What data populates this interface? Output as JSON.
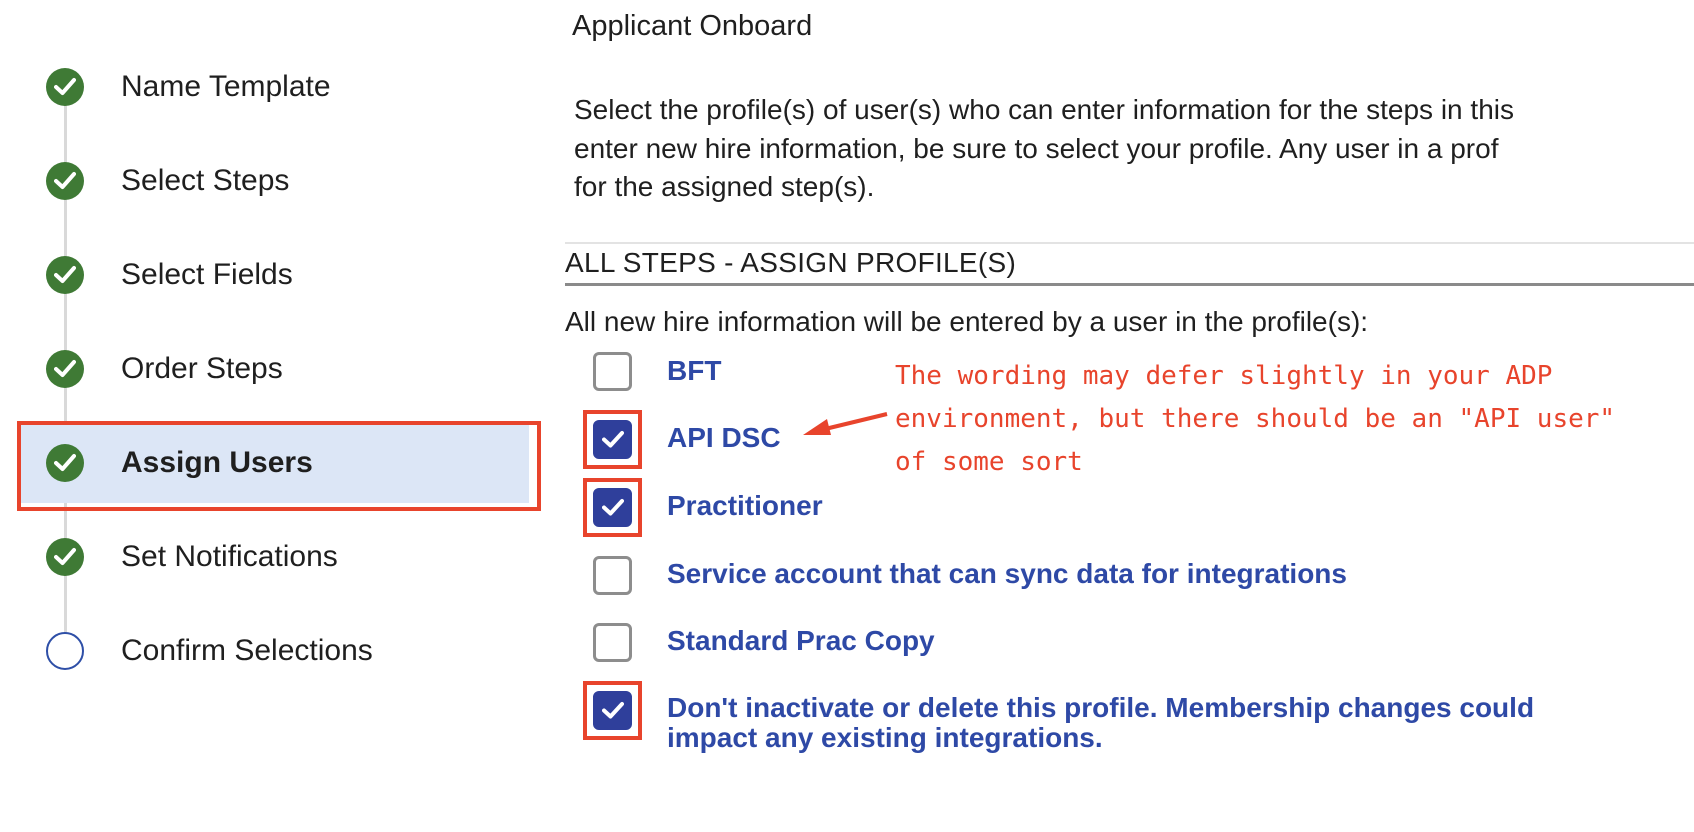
{
  "sidebar": {
    "steps": [
      {
        "label": "Name Template",
        "status": "done"
      },
      {
        "label": "Select Steps",
        "status": "done"
      },
      {
        "label": "Select Fields",
        "status": "done"
      },
      {
        "label": "Order Steps",
        "status": "done"
      },
      {
        "label": "Assign Users",
        "status": "done",
        "active": true
      },
      {
        "label": "Set Notifications",
        "status": "done"
      },
      {
        "label": "Confirm Selections",
        "status": "pending"
      }
    ]
  },
  "main": {
    "template_name": "Applicant Onboard",
    "intro_lines": [
      "Select the profile(s) of user(s) who can enter information for the steps in this",
      "enter new hire information, be sure to select your profile. Any user in a prof",
      "for the assigned step(s)."
    ],
    "section_title": "ALL STEPS - ASSIGN PROFILE(S)",
    "prompt": "All new hire information will be entered by a user in the profile(s):",
    "options": [
      {
        "label": "BFT",
        "checked": false
      },
      {
        "label": "API DSC",
        "checked": true
      },
      {
        "label": "Practitioner",
        "checked": true
      },
      {
        "label": "Service account that can sync data for integrations",
        "checked": false
      },
      {
        "label": "Standard Prac Copy",
        "checked": false
      },
      {
        "label": "Don't inactivate or delete this profile. Membership changes could",
        "label_line2": "impact any existing integrations.",
        "checked": true
      }
    ]
  },
  "annotation": {
    "lines": [
      "The wording may defer slightly in your ADP",
      "environment, but there should be an \"API user\"",
      "of some sort"
    ],
    "color": "#e8442c"
  },
  "colors": {
    "done": "#3f7a35",
    "active_bg": "#dce6f6",
    "link": "#2e49a6",
    "checkbox_on": "#2f3f9b",
    "highlight": "#e8442c"
  }
}
